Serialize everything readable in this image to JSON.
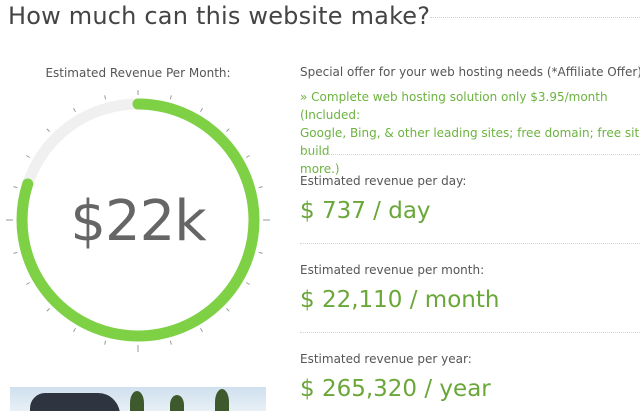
{
  "header": {
    "title": "How much can this website make?"
  },
  "gauge": {
    "label": "Estimated Revenue Per Month:",
    "value_text": "$22k",
    "fill_fraction": 0.8,
    "colors": {
      "fill": "#7ed144",
      "track": "#f0f0f0",
      "ticks": "#9a9a9a",
      "text": "#666666"
    }
  },
  "offer": {
    "heading": "Special offer for your web hosting needs (*Affiliate Offer)",
    "link_line1": "» Complete web hosting solution only $3.95/month (Included:",
    "link_line2": "Google, Bing, & other leading sites; free domain; free site build",
    "link_line3": "more.)"
  },
  "stats": [
    {
      "label": "Estimated revenue per day:",
      "value": "$ 737 / day"
    },
    {
      "label": "Estimated revenue per month:",
      "value": "$ 22,110 / month"
    },
    {
      "label": "Estimated revenue per year:",
      "value": "$ 265,320 / year"
    }
  ],
  "colors": {
    "accent": "#6aa739",
    "link": "#6cb33f",
    "text": "#555555"
  }
}
